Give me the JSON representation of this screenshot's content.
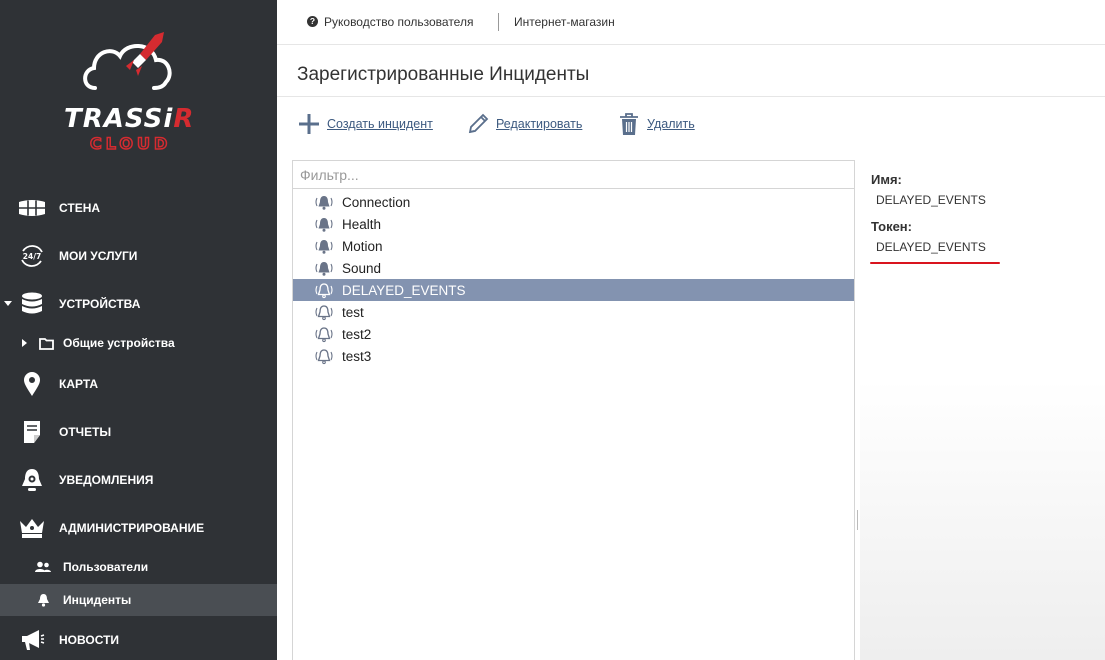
{
  "logo": {
    "line1_a": "TRASS",
    "line1_b": "i",
    "line1_c": "R",
    "line2": "CLOUD"
  },
  "sidebar": {
    "items": [
      {
        "label": "СТЕНА",
        "icon": "video-wall-icon"
      },
      {
        "label": "МОИ УСЛУГИ",
        "icon": "24-7-icon"
      },
      {
        "label": "УСТРОЙСТВА",
        "icon": "database-icon"
      },
      {
        "label": "Общие устройства",
        "icon": "folder-icon"
      },
      {
        "label": "КАРТА",
        "icon": "map-pin-icon"
      },
      {
        "label": "ОТЧЕТЫ",
        "icon": "report-icon"
      },
      {
        "label": "УВЕДОМЛЕНИЯ",
        "icon": "bell-gear-icon"
      },
      {
        "label": "АДМИНИСТРИРОВАНИЕ",
        "icon": "crown-icon"
      },
      {
        "label": "Пользователи",
        "icon": "users-icon"
      },
      {
        "label": "Инциденты",
        "icon": "bell-icon"
      },
      {
        "label": "НОВОСТИ",
        "icon": "megaphone-icon"
      }
    ]
  },
  "topbar": {
    "guide": "Руководство пользователя",
    "shop": "Интернет-магазин"
  },
  "page": {
    "title": "Зарегистрированные Инциденты"
  },
  "toolbar": {
    "create": "Создать инцидент",
    "edit": "Редактировать",
    "delete": "Удалить"
  },
  "filter": {
    "placeholder": "Фильтр..."
  },
  "incidents": [
    {
      "name": "Connection",
      "icon": "alarm-bell-filled-icon"
    },
    {
      "name": "Health",
      "icon": "alarm-bell-filled-icon"
    },
    {
      "name": "Motion",
      "icon": "alarm-bell-filled-icon"
    },
    {
      "name": "Sound",
      "icon": "alarm-bell-filled-icon"
    },
    {
      "name": "DELAYED_EVENTS",
      "icon": "alarm-bell-outline-icon",
      "selected": true
    },
    {
      "name": "test",
      "icon": "alarm-bell-outline-icon"
    },
    {
      "name": "test2",
      "icon": "alarm-bell-outline-icon"
    },
    {
      "name": "test3",
      "icon": "alarm-bell-outline-icon"
    }
  ],
  "details": {
    "name_label": "Имя:",
    "name_value": "DELAYED_EVENTS",
    "token_label": "Токен:",
    "token_value": "DELAYED_EVENTS"
  },
  "colors": {
    "sidebar_bg": "#2f3236",
    "sidebar_active": "#4a4e53",
    "selected_row": "#8393b0",
    "link": "#3d5a80",
    "accent_red": "#d52b30"
  }
}
